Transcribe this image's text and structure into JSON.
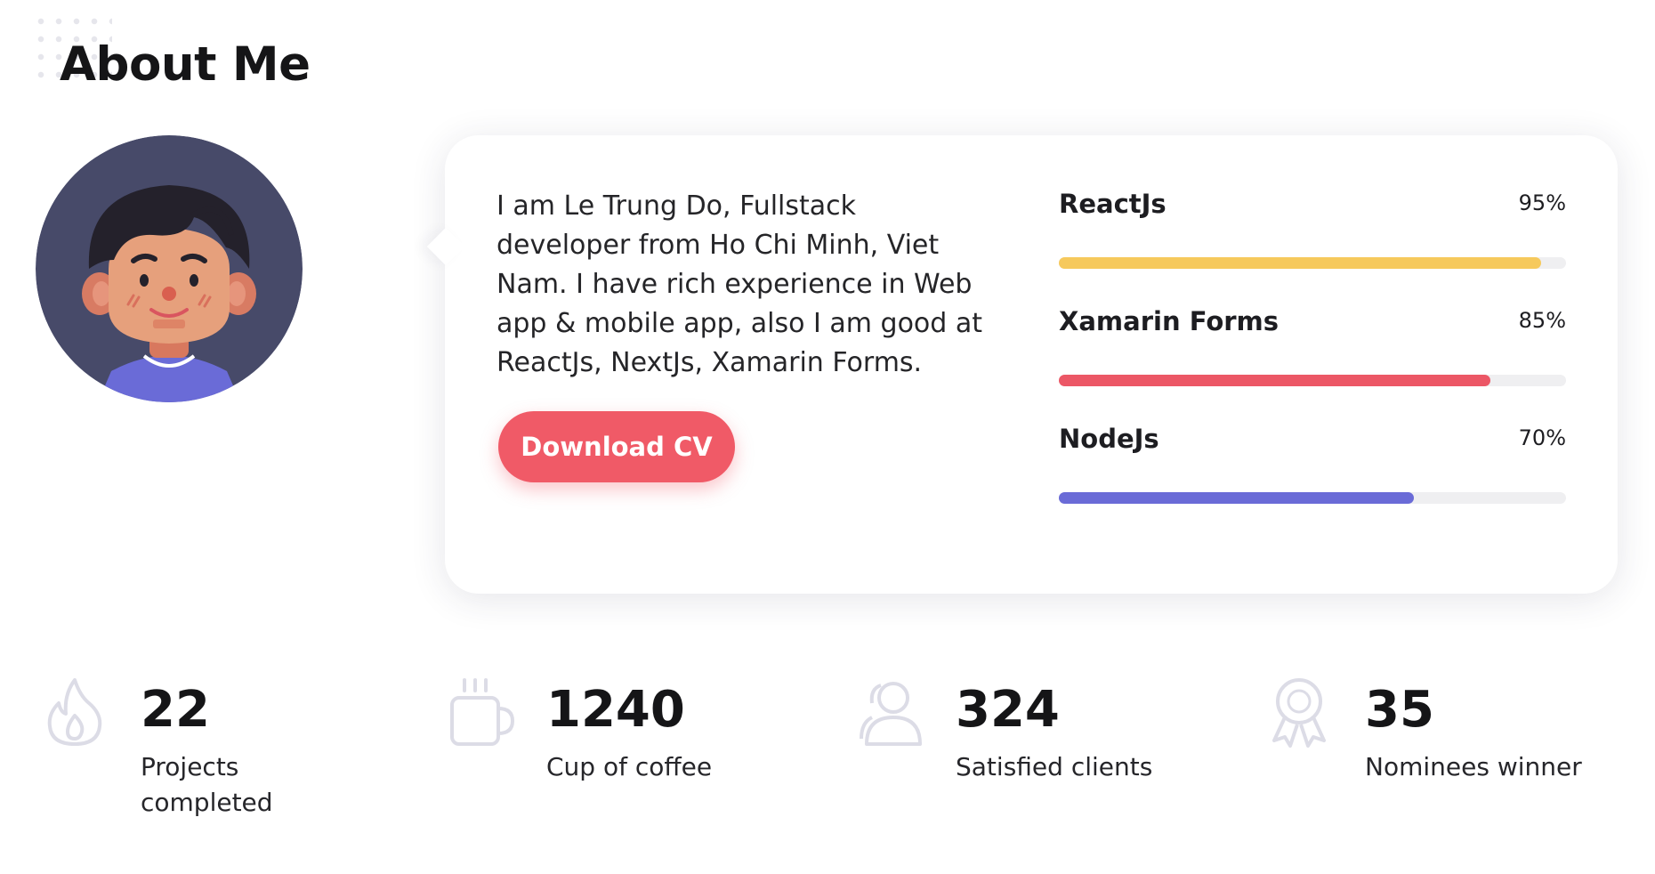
{
  "section": {
    "title": "About Me"
  },
  "bio": {
    "text": "I am Le Trung Do, Fullstack developer from Ho Chi Minh, Viet Nam. I have rich experience in Web app & mobile app, also I am good at ReactJs, NextJs, Xamarin Forms.",
    "button_label": "Download CV"
  },
  "skills": [
    {
      "name": "ReactJs",
      "percent_label": "95%",
      "level": 0.95,
      "color": "#f6c95c"
    },
    {
      "name": "Xamarin Forms",
      "percent_label": "85%",
      "level": 0.85,
      "color": "#ec5766"
    },
    {
      "name": "NodeJs",
      "percent_label": "70%",
      "level": 0.7,
      "color": "#6a6bd7"
    }
  ],
  "stats": [
    {
      "icon": "fire-icon",
      "value": "22",
      "label": "Projects completed"
    },
    {
      "icon": "coffee-cup-icon",
      "value": "1240",
      "label": "Cup of coffee"
    },
    {
      "icon": "users-icon",
      "value": "324",
      "label": "Satisfied clients"
    },
    {
      "icon": "award-ribbon-icon",
      "value": "35",
      "label": "Nominees winner"
    }
  ],
  "colors": {
    "accent": "#f05a67",
    "avatar_background": "#474a69",
    "icon_stroke": "#dcdce6"
  }
}
